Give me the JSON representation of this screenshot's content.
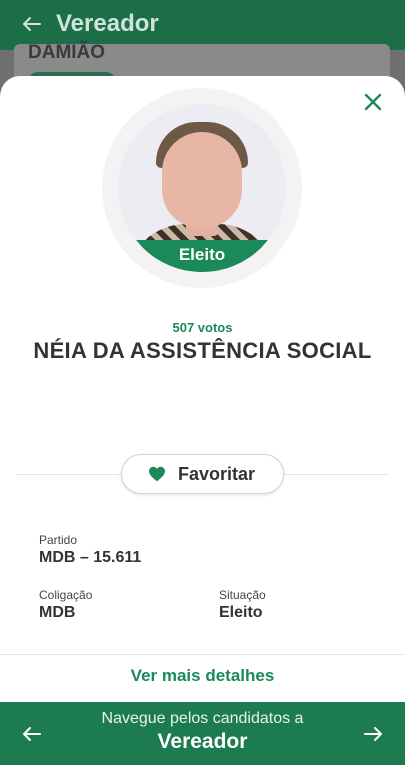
{
  "appbar": {
    "title": "Vereador",
    "back_icon": "arrow-left-icon"
  },
  "underlay": {
    "peek_name": "DAMIÃO"
  },
  "sheet": {
    "close_icon": "close-icon",
    "photo_badge": "Eleito",
    "votes": "507 votos",
    "candidate_name": "NÉIA DA ASSISTÊNCIA SOCIAL",
    "favorite": {
      "label": "Favoritar",
      "icon": "heart-icon"
    },
    "fields": {
      "partido": {
        "label": "Partido",
        "value": "MDB – 15.611"
      },
      "coligacao": {
        "label": "Coligação",
        "value": "MDB"
      },
      "situacao": {
        "label": "Situação",
        "value": "Eleito"
      }
    },
    "more_details": "Ver mais detalhes"
  },
  "bottom_nav": {
    "subtitle": "Navegue pelos candidatos a",
    "role": "Vereador",
    "prev_icon": "arrow-left-icon",
    "next_icon": "arrow-right-icon"
  },
  "colors": {
    "brand_green": "#1c7c50",
    "accent_green": "#1a8a5a"
  }
}
